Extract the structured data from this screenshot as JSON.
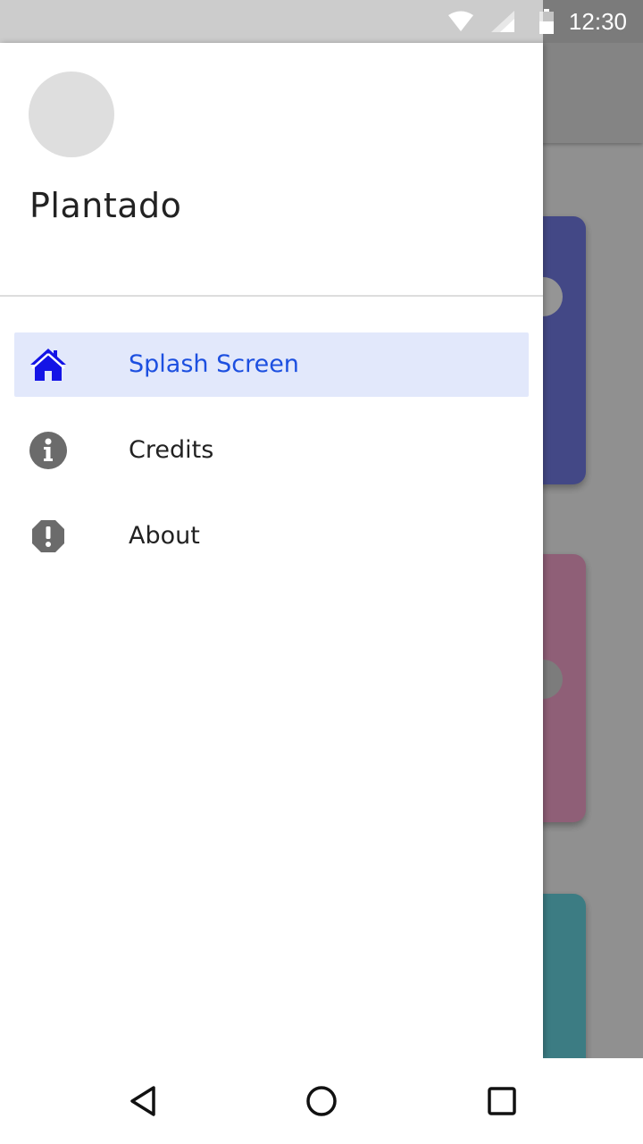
{
  "status_bar": {
    "time": "12:30",
    "icons": [
      "wifi-icon",
      "signal-icon",
      "battery-icon"
    ]
  },
  "drawer": {
    "title": "Plantado",
    "items": [
      {
        "label": "Splash Screen",
        "icon": "home-icon",
        "active": true
      },
      {
        "label": "Credits",
        "icon": "info-icon",
        "active": false
      },
      {
        "label": "About",
        "icon": "alert-octagon-icon",
        "active": false
      }
    ]
  },
  "nav_bar": {
    "buttons": [
      "back-button",
      "home-button",
      "recents-button"
    ]
  },
  "colors": {
    "active_item_bg": "#e2e8fb",
    "active_item_text": "#1c4fe0",
    "home_icon": "#1414e6",
    "icon_gray": "#6b6b6b",
    "card_1": "#6d74d8",
    "card_2": "#e79ac0",
    "card_3": "#62c9d4"
  }
}
